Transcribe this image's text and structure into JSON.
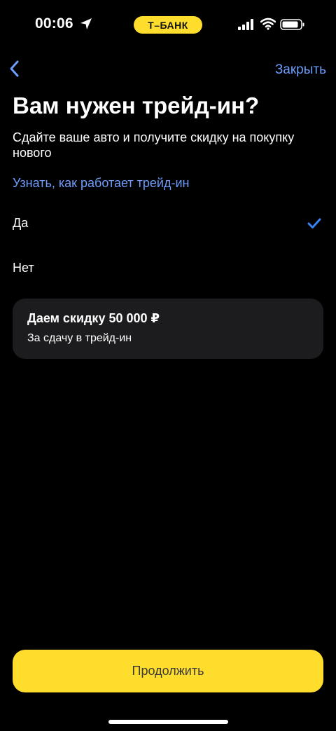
{
  "status_bar": {
    "time": "00:06",
    "carrier": "Т–БАНК",
    "icons": [
      "location-arrow-icon",
      "signal-icon",
      "wifi-icon",
      "battery-icon"
    ],
    "carrier_color": "#FFDD2D"
  },
  "nav": {
    "back_icon": "chevron-left-icon",
    "close_label": "Закрыть",
    "link_color": "#6E9DFB"
  },
  "page": {
    "title": "Вам нужен трейд-ин?",
    "subtitle": "Сдайте ваше авто и получите скидку на покупку нового",
    "learn_link": "Узнать, как работает трейд-ин"
  },
  "options": [
    {
      "label": "Да",
      "selected": true
    },
    {
      "label": "Нет",
      "selected": false
    }
  ],
  "promo_card": {
    "title": "Даем скидку 50 000 ₽",
    "subtitle": "За сдачу в трейд-ин"
  },
  "footer": {
    "continue_label": "Продолжить",
    "button_color": "#FFDD2D"
  }
}
